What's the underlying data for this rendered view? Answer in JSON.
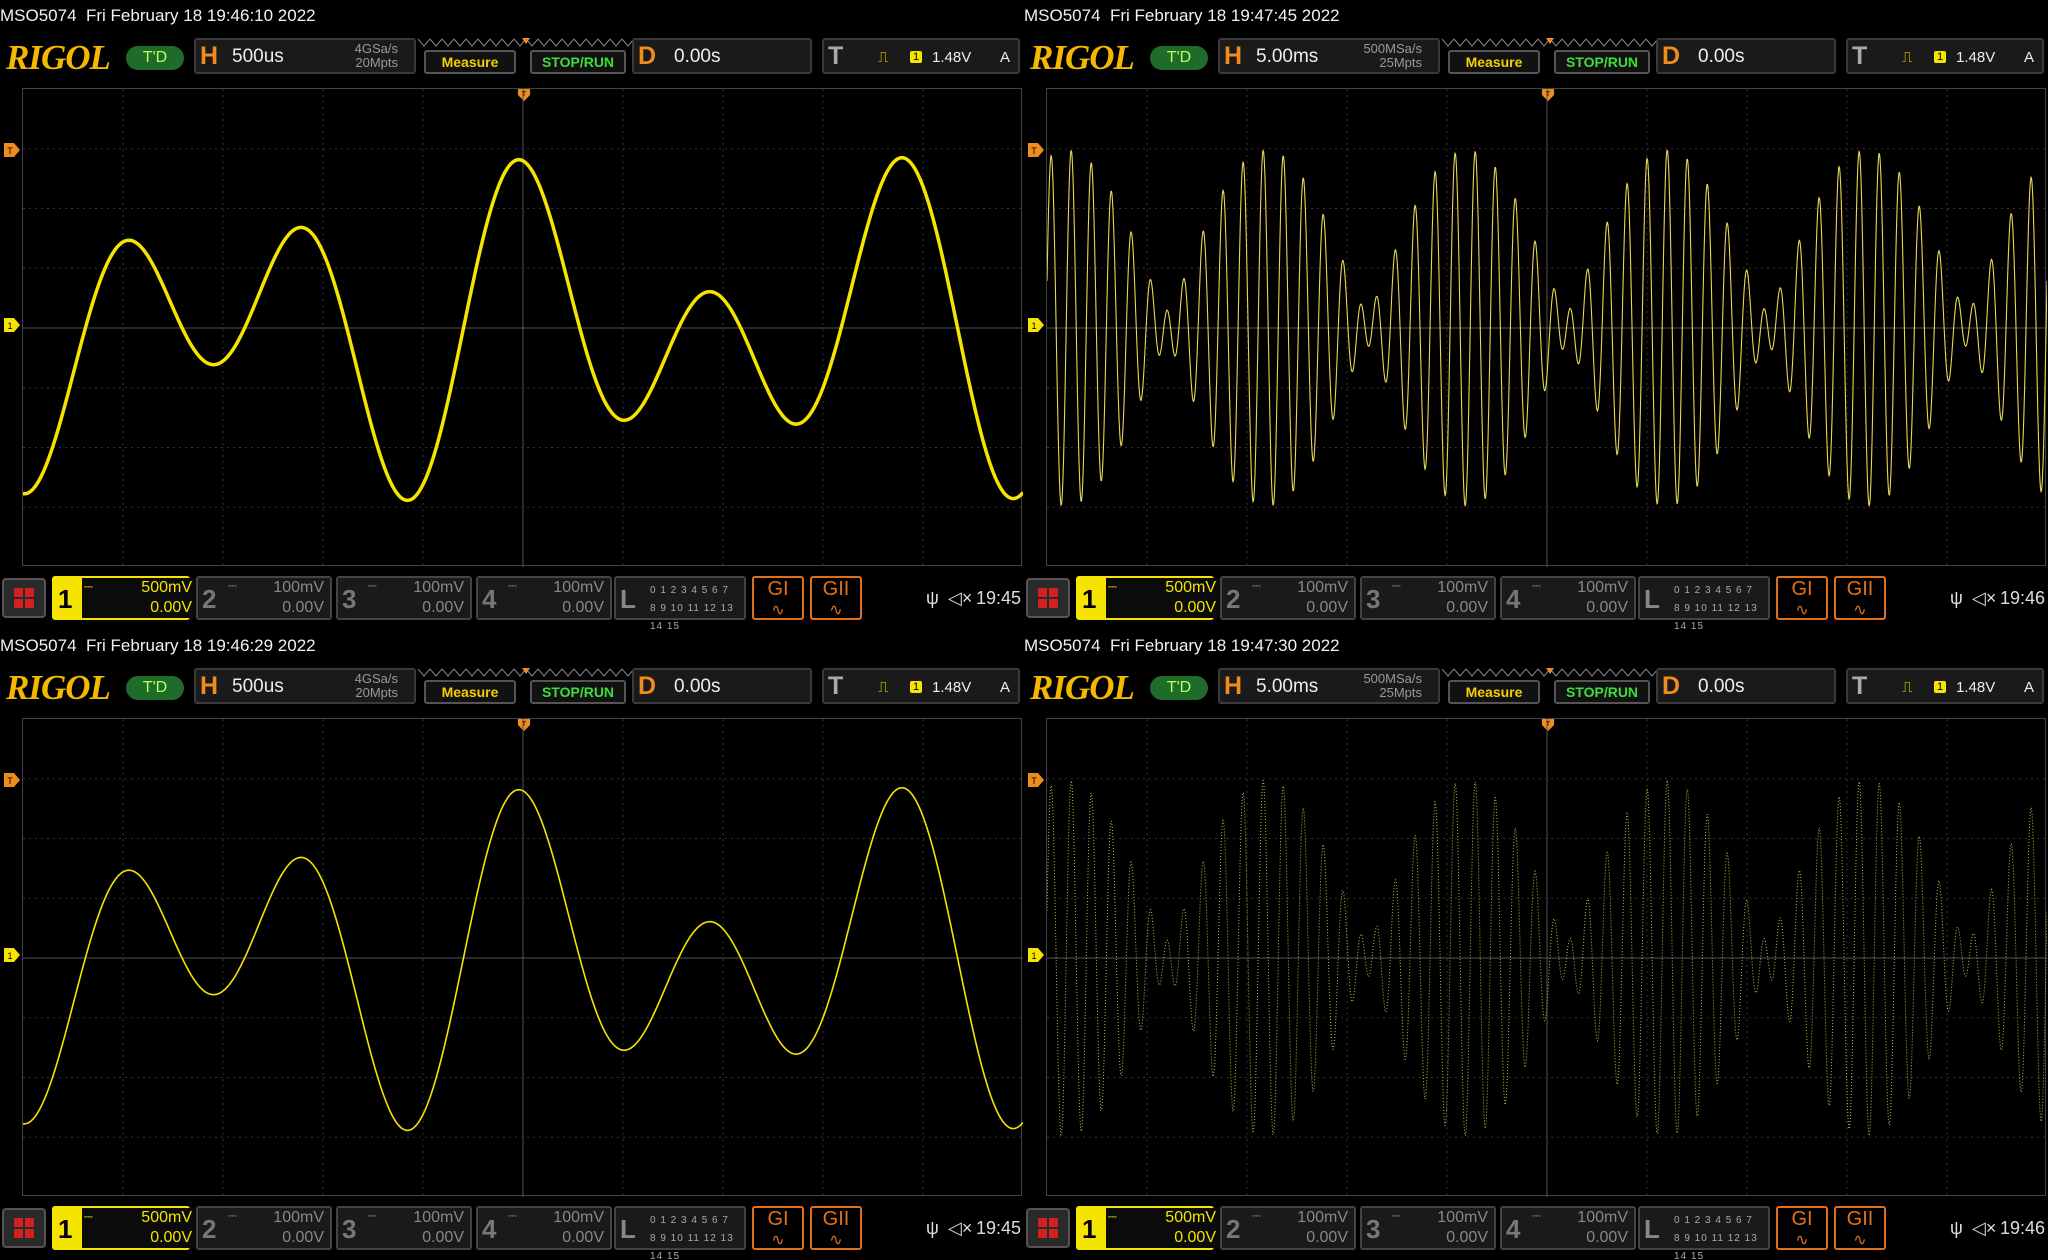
{
  "colors": {
    "accent": "#f5b800",
    "trace": "#f5e400",
    "orange": "#f08c1e",
    "green": "#3cde3c"
  },
  "panels": [
    {
      "title": "MSO5074  Fri February 18 19:46:10 2022",
      "logo": "RIGOL",
      "td": "T'D",
      "h_label": "H",
      "h_value": "500us",
      "sample_rate": "4GSa/s",
      "mem_depth": "20Mpts",
      "measure": "Measure",
      "stoprun": "STOP/RUN",
      "d_label": "D",
      "d_value": "0.00s",
      "t_label": "T",
      "trig_ch": "1",
      "trig_level": "1.48V",
      "trig_mode": "A",
      "ch1_scale": "500mV",
      "ch1_offset": "0.00V",
      "ch2_scale": "100mV",
      "ch2_offset": "0.00V",
      "ch3_scale": "100mV",
      "ch3_offset": "0.00V",
      "ch4_scale": "100mV",
      "ch4_offset": "0.00V",
      "l_label": "L",
      "l_bits_1": "0 1 2 3  4 5 6 7",
      "l_bits_2": "8 9 10 11 12 13 14 15",
      "g1": "GI",
      "g2": "GII",
      "time": "19:45",
      "ch_labels": [
        "1",
        "2",
        "3",
        "4"
      ],
      "style": "thick"
    },
    {
      "title": "MSO5074  Fri February 18 19:47:45 2022",
      "logo": "RIGOL",
      "td": "T'D",
      "h_label": "H",
      "h_value": "5.00ms",
      "sample_rate": "500MSa/s",
      "mem_depth": "25Mpts",
      "measure": "Measure",
      "stoprun": "STOP/RUN",
      "d_label": "D",
      "d_value": "0.00s",
      "t_label": "T",
      "trig_ch": "1",
      "trig_level": "1.48V",
      "trig_mode": "A",
      "ch1_scale": "500mV",
      "ch1_offset": "0.00V",
      "ch2_scale": "100mV",
      "ch2_offset": "0.00V",
      "ch3_scale": "100mV",
      "ch3_offset": "0.00V",
      "ch4_scale": "100mV",
      "ch4_offset": "0.00V",
      "l_label": "L",
      "l_bits_1": "0 1 2 3  4 5 6 7",
      "l_bits_2": "8 9 10 11 12 13 14 15",
      "g1": "GI",
      "g2": "GII",
      "time": "19:46",
      "ch_labels": [
        "1",
        "2",
        "3",
        "4"
      ],
      "style": "dense"
    },
    {
      "title": "MSO5074  Fri February 18 19:46:29 2022",
      "logo": "RIGOL",
      "td": "T'D",
      "h_label": "H",
      "h_value": "500us",
      "sample_rate": "4GSa/s",
      "mem_depth": "20Mpts",
      "measure": "Measure",
      "stoprun": "STOP/RUN",
      "d_label": "D",
      "d_value": "0.00s",
      "t_label": "T",
      "trig_ch": "1",
      "trig_level": "1.48V",
      "trig_mode": "A",
      "ch1_scale": "500mV",
      "ch1_offset": "0.00V",
      "ch2_scale": "100mV",
      "ch2_offset": "0.00V",
      "ch3_scale": "100mV",
      "ch3_offset": "0.00V",
      "ch4_scale": "100mV",
      "ch4_offset": "0.00V",
      "l_label": "L",
      "l_bits_1": "0 1 2 3  4 5 6 7",
      "l_bits_2": "8 9 10 11 12 13 14 15",
      "g1": "GI",
      "g2": "GII",
      "time": "19:45",
      "ch_labels": [
        "1",
        "2",
        "3",
        "4"
      ],
      "style": "thin"
    },
    {
      "title": "MSO5074  Fri February 18 19:47:30 2022",
      "logo": "RIGOL",
      "td": "T'D",
      "h_label": "H",
      "h_value": "5.00ms",
      "sample_rate": "500MSa/s",
      "mem_depth": "25Mpts",
      "measure": "Measure",
      "stoprun": "STOP/RUN",
      "d_label": "D",
      "d_value": "0.00s",
      "t_label": "T",
      "trig_ch": "1",
      "trig_level": "1.48V",
      "trig_mode": "A",
      "ch1_scale": "500mV",
      "ch1_offset": "0.00V",
      "ch2_scale": "100mV",
      "ch2_offset": "0.00V",
      "ch3_scale": "100mV",
      "ch3_offset": "0.00V",
      "ch4_scale": "100mV",
      "ch4_offset": "0.00V",
      "l_label": "L",
      "l_bits_1": "0 1 2 3  4 5 6 7",
      "l_bits_2": "8 9 10 11 12 13 14 15",
      "g1": "GI",
      "g2": "GII",
      "time": "19:46",
      "ch_labels": [
        "1",
        "2",
        "3",
        "4"
      ],
      "style": "dotted"
    }
  ]
}
